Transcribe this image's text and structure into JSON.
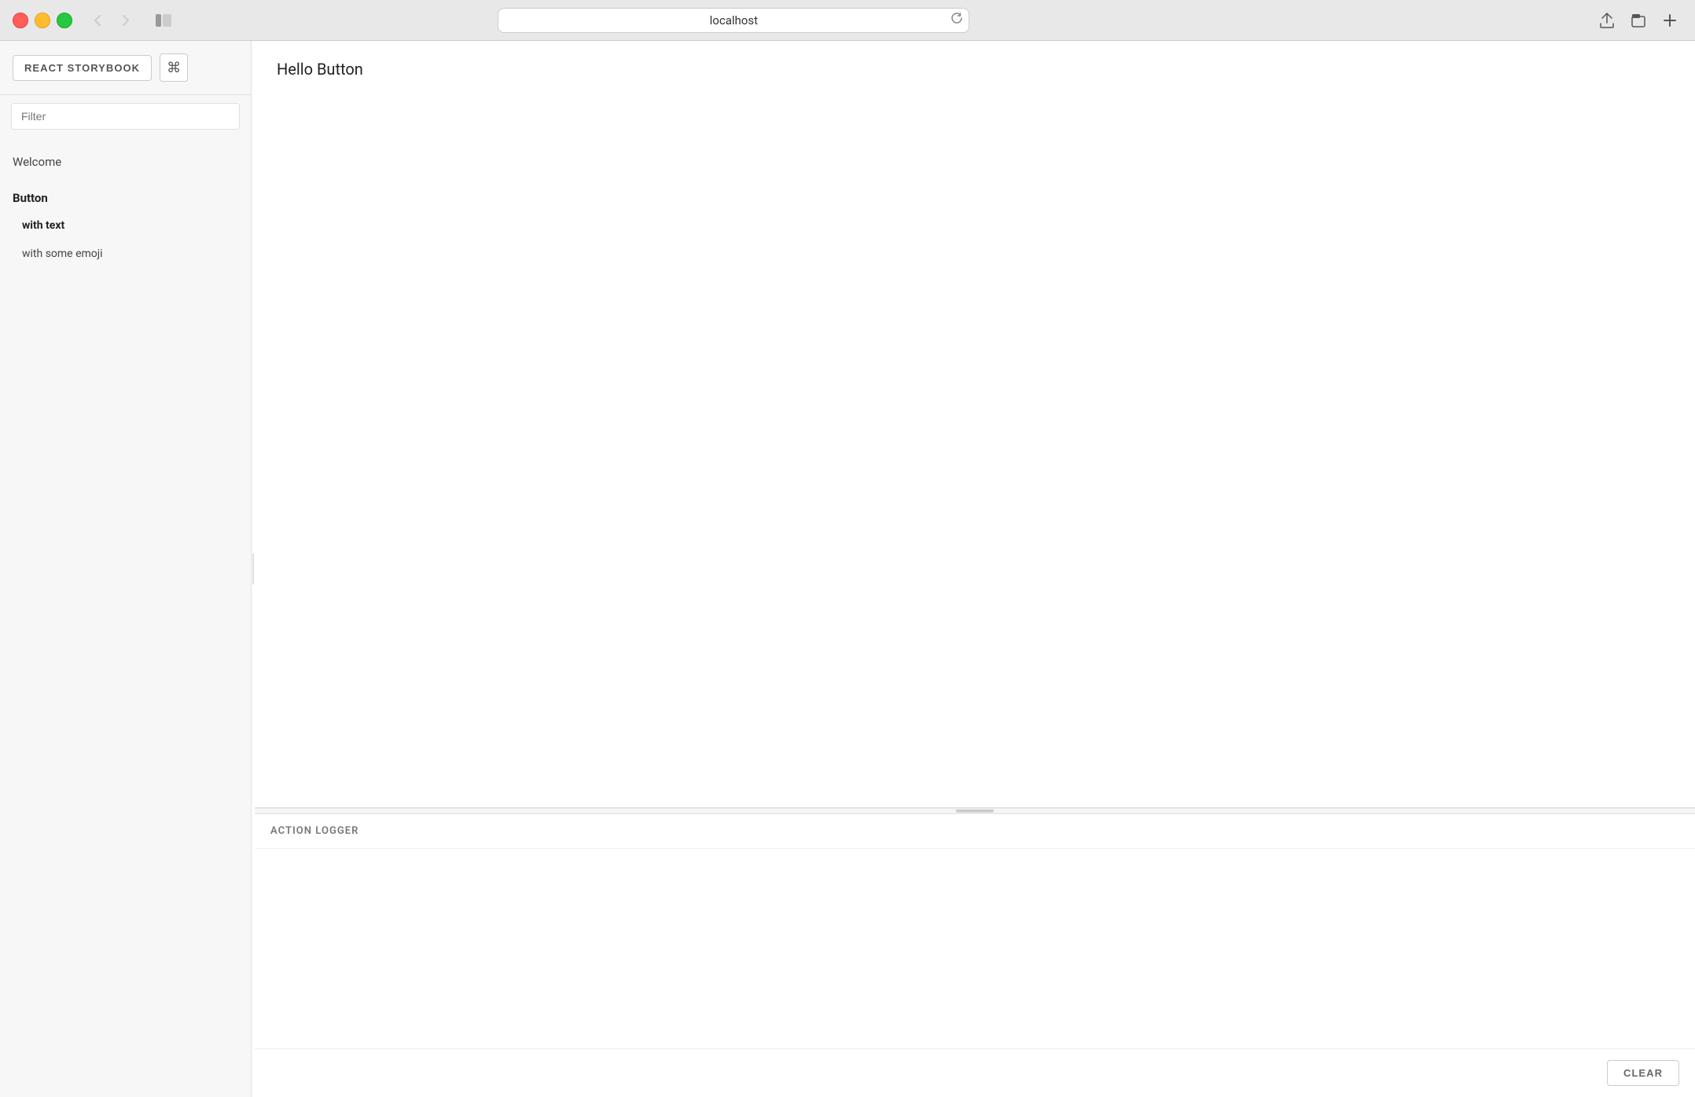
{
  "browser": {
    "url": "localhost",
    "back_disabled": true,
    "forward_disabled": true
  },
  "storybook": {
    "logo_label": "REACT STORYBOOK",
    "keyboard_shortcut": "⌘",
    "filter_placeholder": "Filter",
    "sidebar": {
      "items": [
        {
          "id": "welcome",
          "label": "Welcome",
          "type": "group",
          "bold": false
        },
        {
          "id": "button",
          "label": "Button",
          "type": "group",
          "bold": true
        },
        {
          "id": "with-text",
          "label": "with text",
          "type": "item",
          "active": true
        },
        {
          "id": "with-some-emoji",
          "label": "with some emoji",
          "type": "item",
          "active": false
        }
      ]
    },
    "preview": {
      "story_title": "Hello Button"
    },
    "action_logger": {
      "header": "ACTION LOGGER",
      "clear_label": "CLEAR"
    }
  }
}
